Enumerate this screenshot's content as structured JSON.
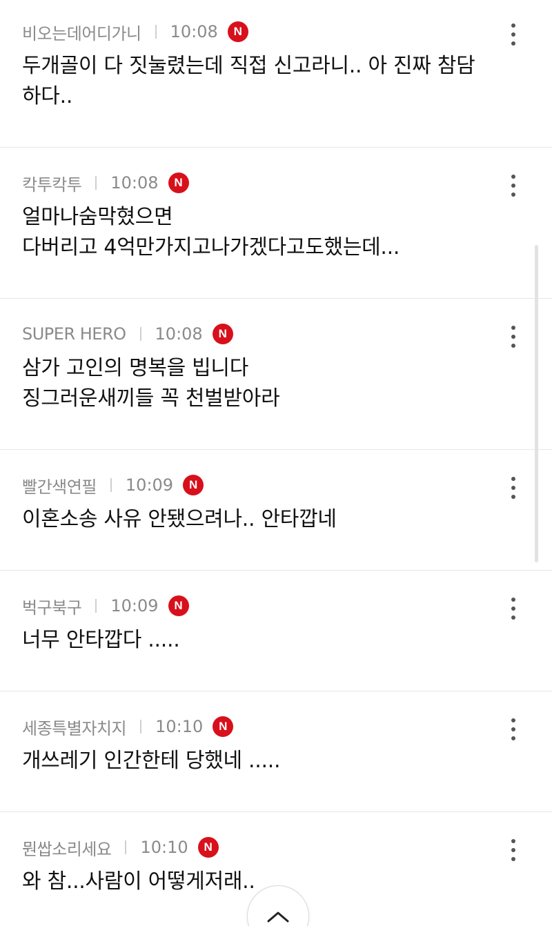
{
  "comments": [
    {
      "author": "비오는데어디가니",
      "time": "10:08",
      "badge": "N",
      "lines": [
        "두개골이 다 짓눌렸는데 직접 신고라니.. 아 진짜 참담",
        "하다.."
      ]
    },
    {
      "author": "칵투칵투",
      "time": "10:08",
      "badge": "N",
      "lines": [
        "얼마나숨막혔으면",
        "다버리고 4억만가지고나가겠다고도했는데..."
      ]
    },
    {
      "author": "SUPER HERO",
      "time": "10:08",
      "badge": "N",
      "lines": [
        "삼가 고인의 명복을 빕니다",
        "징그러운새끼들 꼭 천벌받아라"
      ]
    },
    {
      "author": "빨간색연필",
      "time": "10:09",
      "badge": "N",
      "lines": [
        "이혼소송 사유 안됐으려나.. 안타깝네"
      ]
    },
    {
      "author": "벅구북구",
      "time": "10:09",
      "badge": "N",
      "lines": [
        "너무 안타깝다 ....."
      ]
    },
    {
      "author": "세종특별자치지",
      "time": "10:10",
      "badge": "N",
      "lines": [
        "개쓰레기 인간한테 당했네 ....."
      ]
    },
    {
      "author": "뭔쌉소리세요",
      "time": "10:10",
      "badge": "N",
      "lines": [
        "와 참...사람이 어떻게저래.."
      ]
    }
  ],
  "colors": {
    "badge": "#d8101b",
    "meta_text": "#8a8a8a",
    "body_text": "#111111",
    "divider": "#e6e6e6"
  },
  "icons": {
    "more": "more-vertical-icon",
    "scroll_top": "chevron-up-icon"
  }
}
